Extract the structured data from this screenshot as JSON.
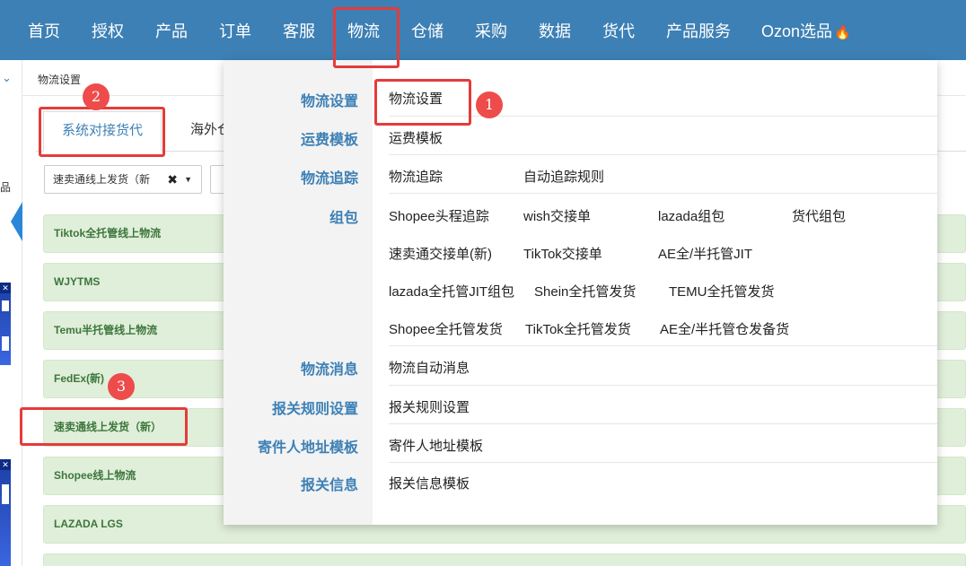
{
  "nav": {
    "items": [
      "首页",
      "授权",
      "产品",
      "订单",
      "客服",
      "物流",
      "仓储",
      "采购",
      "数据",
      "货代",
      "产品服务",
      "Ozon选品"
    ],
    "active": "物流",
    "flame_icon": "flame-icon"
  },
  "left": {
    "chevron": "⌄",
    "partial_text": "品"
  },
  "breadcrumb": "物流设置",
  "tabs": {
    "tab1": "系统对接货代",
    "tab2": "海外仓"
  },
  "filter": {
    "selected": "速卖通线上发货（新",
    "clear": "✖",
    "caret": "▼"
  },
  "rows": [
    "Tiktok全托管线上物流",
    "WJYTMS",
    "Temu半托管线上物流",
    "FedEx(新)",
    "速卖通线上发货（新）",
    "Shopee线上物流",
    "LAZADA LGS"
  ],
  "menu": {
    "categories": [
      "物流设置",
      "运费模板",
      "物流追踪",
      "组包",
      "物流消息",
      "报关规则设置",
      "寄件人地址模板",
      "报关信息"
    ],
    "links": {
      "logistics_settings": "物流设置",
      "freight_template": "运费模板",
      "tracking": "物流追踪",
      "auto_tracking_rule": "自动追踪规则",
      "pack": [
        "Shopee头程追踪",
        "wish交接单",
        "lazada组包",
        "货代组包",
        "速卖通交接单(新)",
        "TikTok交接单",
        "AE全/半托管JIT",
        "lazada全托管JIT组包",
        "Shein全托管发货",
        "TEMU全托管发货",
        "Shopee全托管发货",
        "TikTok全托管发货",
        "AE全/半托管仓发备货"
      ],
      "auto_message": "物流自动消息",
      "customs_rule": "报关规则设置",
      "sender_template": "寄件人地址模板",
      "customs_info_template": "报关信息模板"
    }
  },
  "badges": [
    "1",
    "2",
    "3"
  ],
  "colors": {
    "nav": "#3d80b5",
    "accent": "#3d80b5",
    "row_bg": "#e0efd9",
    "annotation": "#e53b3b"
  }
}
